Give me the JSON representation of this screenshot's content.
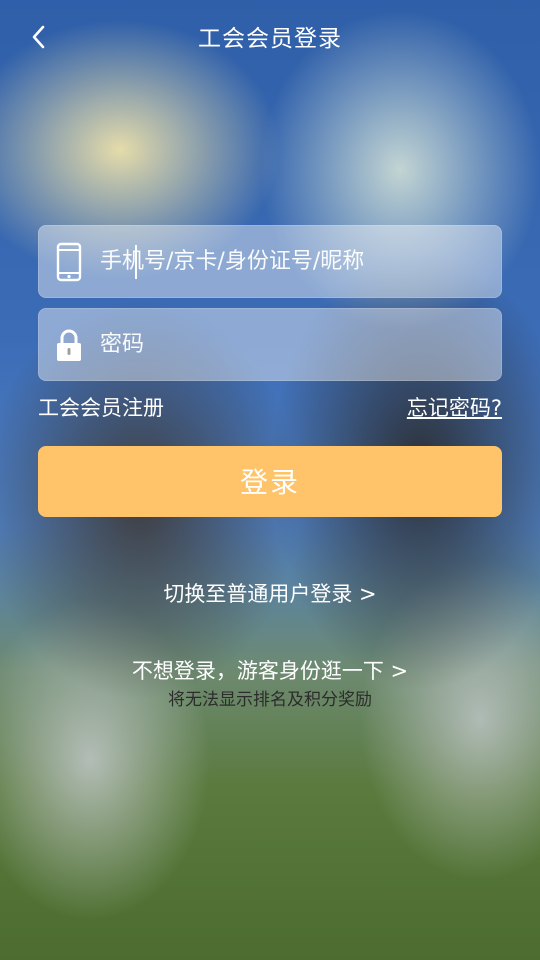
{
  "header": {
    "title": "工会会员登录",
    "back_icon": "chevron-left-icon"
  },
  "form": {
    "account_placeholder": "手机号/京卡/身份证号/昵称",
    "account_icon": "phone-icon",
    "password_placeholder": "密码",
    "password_icon": "lock-icon"
  },
  "links": {
    "register": "工会会员注册",
    "forgot": "忘记密码?"
  },
  "login_button": {
    "label": "登录",
    "color": "#ffc369"
  },
  "switch": {
    "label": "切换至普通用户登录 >"
  },
  "guest": {
    "label": "不想登录，游客身份逛一下 >",
    "note": "将无法显示排名及积分奖励"
  }
}
